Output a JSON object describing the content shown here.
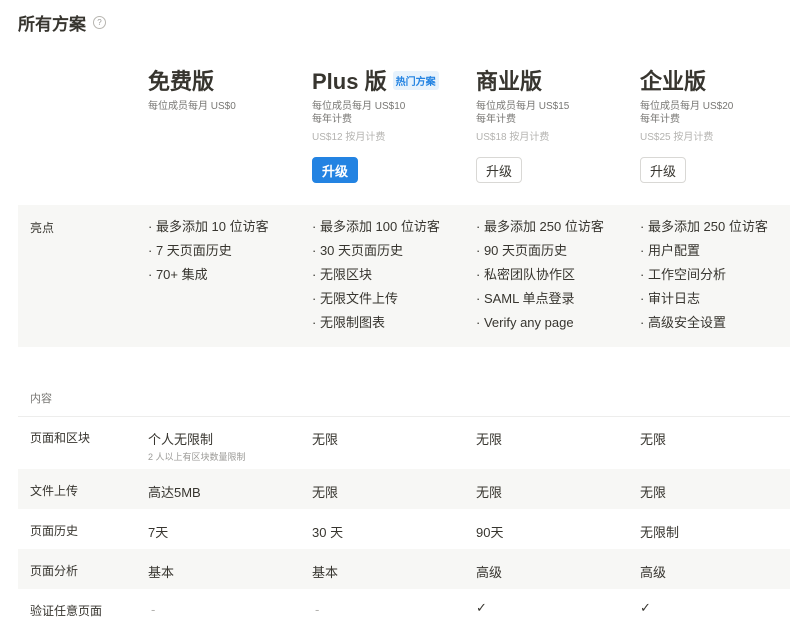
{
  "page": {
    "title": "所有方案",
    "help_icon": "?"
  },
  "plans": [
    {
      "name": "免费版",
      "price_line1": "每位成员每月 US$0",
      "price_line2": "",
      "price_monthly": "",
      "badge": "",
      "button": ""
    },
    {
      "name": "Plus 版",
      "badge": "热门方案",
      "price_line1": "每位成员每月 US$10",
      "price_line2": "每年计费",
      "price_monthly": "US$12 按月计费",
      "button": "升级"
    },
    {
      "name": "商业版",
      "badge": "",
      "price_line1": "每位成员每月 US$15",
      "price_line2": "每年计费",
      "price_monthly": "US$18 按月计费",
      "button": "升级"
    },
    {
      "name": "企业版",
      "badge": "",
      "price_line1": "每位成员每月 US$20",
      "price_line2": "每年计费",
      "price_monthly": "US$25 按月计费",
      "button": "升级"
    }
  ],
  "highlights": {
    "label": "亮点",
    "columns": [
      [
        "· 最多添加 10 位访客",
        "· 7 天页面历史",
        "· 70+ 集成"
      ],
      [
        "· 最多添加 100 位访客",
        "· 30 天页面历史",
        "· 无限区块",
        "· 无限文件上传",
        "· 无限制图表"
      ],
      [
        "· 最多添加 250 位访客",
        "· 90 天页面历史",
        "· 私密团队协作区",
        "· SAML 单点登录",
        "· Verify any page"
      ],
      [
        "· 最多添加 250 位访客",
        "· 用户配置",
        "· 工作空间分析",
        "· 审计日志",
        "· 高级安全设置"
      ]
    ]
  },
  "content_section": {
    "label": "内容",
    "rows": [
      {
        "label": "页面和区块",
        "values": [
          "个人无限制",
          "无限",
          "无限",
          "无限"
        ],
        "sub": "2 人以上有区块数量限制"
      },
      {
        "label": "文件上传",
        "values": [
          "高达5MB",
          "无限",
          "无限",
          "无限"
        ]
      },
      {
        "label": "页面历史",
        "values": [
          "7天",
          "30 天",
          "90天",
          "无限制"
        ]
      },
      {
        "label": "页面分析",
        "values": [
          "基本",
          "基本",
          "高级",
          "高级"
        ]
      },
      {
        "label": "验证任意页面",
        "values": [
          "-",
          "-",
          "✓",
          "✓"
        ]
      }
    ]
  },
  "colors": {
    "accent": "#2383e2",
    "text": "#37352f",
    "muted": "#787774",
    "shade": "#f7f7f5"
  }
}
